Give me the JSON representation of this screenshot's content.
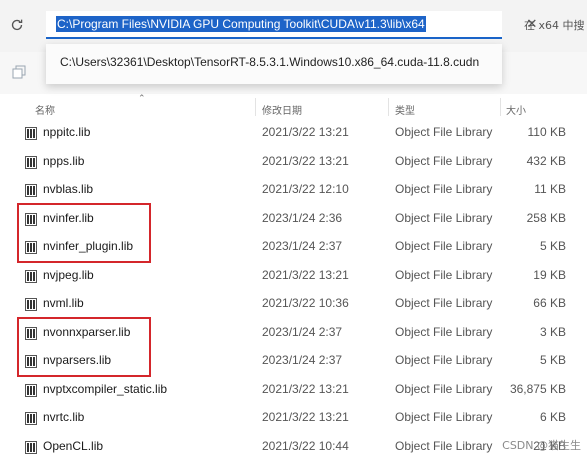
{
  "address_bar": {
    "path": "C:\\Program Files\\NVIDIA GPU Computing Toolkit\\CUDA\\v11.3\\lib\\x64",
    "search_hint": "在 x64 中搜"
  },
  "suggestion": {
    "path": "C:\\Users\\32361\\Desktop\\TensorRT-8.5.3.1.Windows10.x86_64.cuda-11.8.cudn"
  },
  "columns": {
    "name": "名称",
    "modified": "修改日期",
    "type": "类型",
    "size": "大小"
  },
  "files": [
    {
      "name": "nppitc.lib",
      "modified": "2021/3/22 13:21",
      "type": "Object File Library",
      "size": "110 KB"
    },
    {
      "name": "npps.lib",
      "modified": "2021/3/22 13:21",
      "type": "Object File Library",
      "size": "432 KB"
    },
    {
      "name": "nvblas.lib",
      "modified": "2021/3/22 12:10",
      "type": "Object File Library",
      "size": "11 KB"
    },
    {
      "name": "nvinfer.lib",
      "modified": "2023/1/24 2:36",
      "type": "Object File Library",
      "size": "258 KB",
      "highlighted": true
    },
    {
      "name": "nvinfer_plugin.lib",
      "modified": "2023/1/24 2:37",
      "type": "Object File Library",
      "size": "5 KB",
      "highlighted": true
    },
    {
      "name": "nvjpeg.lib",
      "modified": "2021/3/22 13:21",
      "type": "Object File Library",
      "size": "19 KB"
    },
    {
      "name": "nvml.lib",
      "modified": "2021/3/22 10:36",
      "type": "Object File Library",
      "size": "66 KB"
    },
    {
      "name": "nvonnxparser.lib",
      "modified": "2023/1/24 2:37",
      "type": "Object File Library",
      "size": "3 KB",
      "highlighted": true
    },
    {
      "name": "nvparsers.lib",
      "modified": "2023/1/24 2:37",
      "type": "Object File Library",
      "size": "5 KB",
      "highlighted": true
    },
    {
      "name": "nvptxcompiler_static.lib",
      "modified": "2021/3/22 13:21",
      "type": "Object File Library",
      "size": "36,875 KB"
    },
    {
      "name": "nvrtc.lib",
      "modified": "2021/3/22 13:21",
      "type": "Object File Library",
      "size": "6 KB"
    },
    {
      "name": "OpenCL.lib",
      "modified": "2021/3/22 10:44",
      "type": "Object File Library",
      "size": "21 KB"
    }
  ],
  "watermark": "CSDN @猫生生",
  "colors": {
    "address_selection": "#1e64c8",
    "address_underline": "#1a64c8",
    "highlight_box": "#d4262b"
  },
  "icons": {
    "refresh": "refresh-icon",
    "clear": "close-icon",
    "file": "library-file-icon",
    "toolbar": "copy-icon"
  }
}
